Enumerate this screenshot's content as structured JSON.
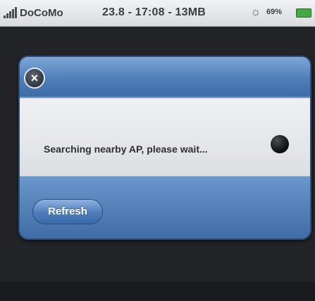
{
  "status_bar": {
    "carrier": "DoCoMo",
    "info": "23.8 - 17:08 - 13MB",
    "battery_percent": "69%",
    "icons": [
      "signal-icon",
      "sync-icon",
      "battery-icon"
    ]
  },
  "dialog": {
    "close_icon": "close-icon",
    "message": "Searching nearby AP, please wait...",
    "spinner": "spinner-icon",
    "refresh_label": "Refresh"
  },
  "colors": {
    "dialog_blue": "#4f7eb8",
    "battery_green": "#48a843"
  }
}
